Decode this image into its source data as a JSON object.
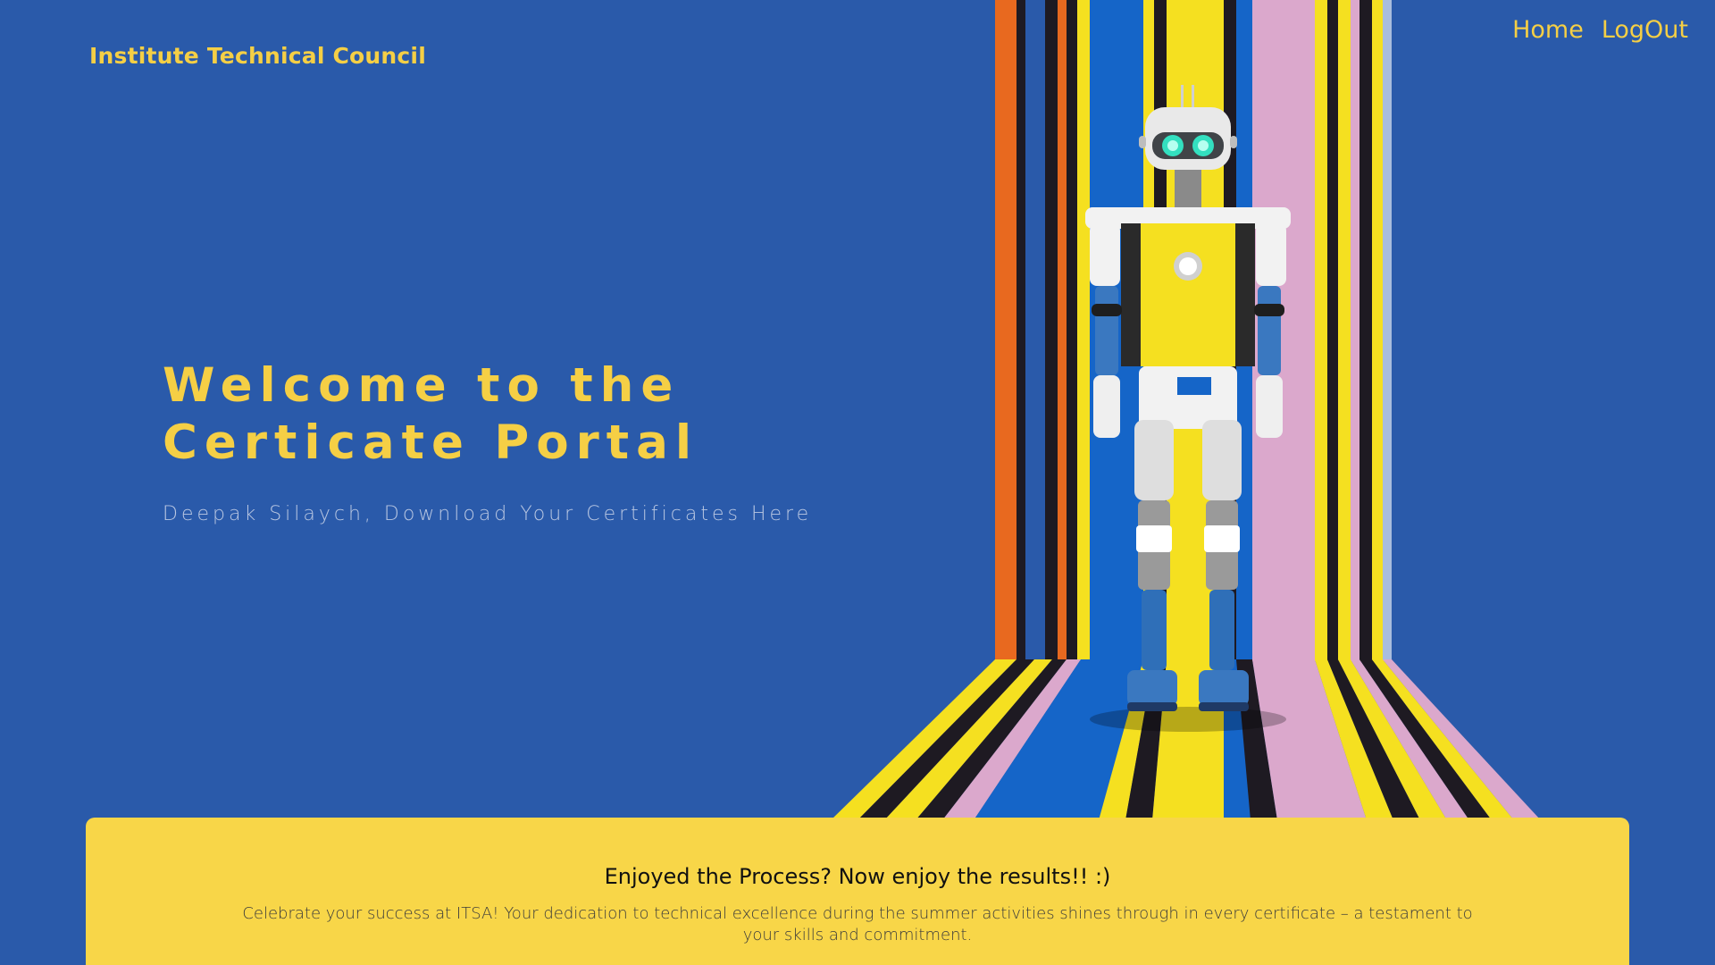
{
  "header": {
    "brand": "Institute Technical Council",
    "nav": {
      "home_label": "Home",
      "logout_label": "LogOut"
    }
  },
  "hero": {
    "title_line1": "Welcome to the",
    "title_line2": "Certicate Portal",
    "subtitle": "Deepak Silaych, Download Your Certificates Here"
  },
  "card": {
    "title": "Enjoyed the Process? Now enjoy the results!! :)",
    "text": "Celebrate your success at ITSA! Your dedication to technical excellence during the summer activities shines through in every certificate – a testament to your skills and commitment."
  },
  "colors": {
    "background": "#2a5aaa",
    "accent_yellow": "#f5cf45",
    "card_yellow": "#f8d648",
    "stripe_orange": "#e8691f",
    "stripe_pink": "#dba8cc",
    "stripe_dark": "#1e1a22",
    "stripe_blue": "#1565c8"
  },
  "illustration": {
    "icon": "robot-illustration-icon"
  }
}
